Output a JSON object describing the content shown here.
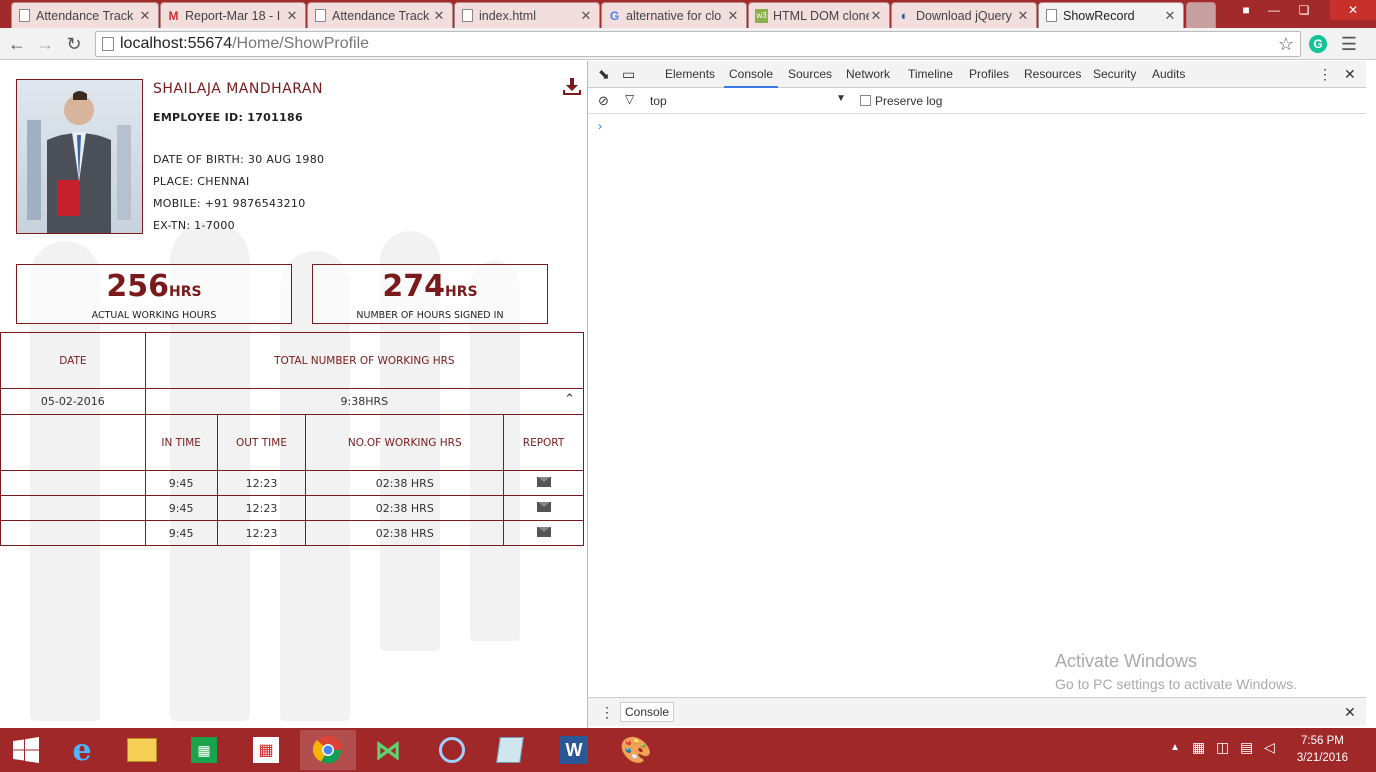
{
  "browser": {
    "tabs": [
      {
        "title": "Attendance Track",
        "icon": "document-icon"
      },
      {
        "title": "Report-Mar 18 - I",
        "icon": "gmail-icon"
      },
      {
        "title": "Attendance Track",
        "icon": "document-icon"
      },
      {
        "title": "index.html",
        "icon": "document-icon"
      },
      {
        "title": "alternative for clo",
        "icon": "google-icon"
      },
      {
        "title": "HTML DOM clone",
        "icon": "w3schools-icon"
      },
      {
        "title": "Download jQuery",
        "icon": "jquery-icon"
      },
      {
        "title": "ShowRecord",
        "icon": "document-icon"
      }
    ],
    "url_host": "localhost:55674",
    "url_path": "/Home/ShowProfile"
  },
  "profile": {
    "name": "SHAILAJA MANDHARAN",
    "employee_id": "EMPLOYEE ID: 1701186",
    "dob": "DATE OF BIRTH: 30 AUG 1980",
    "place": "PLACE: CHENNAI",
    "mobile": "MOBILE: +91 9876543210",
    "ext": "EX-TN: 1-7000"
  },
  "stats": {
    "actual": {
      "value": "256",
      "unit": "HRS",
      "label": "ACTUAL WORKING HOURS"
    },
    "signed": {
      "value": "274",
      "unit": "HRS",
      "label": "NUMBER OF HOURS SIGNED IN"
    }
  },
  "table": {
    "col_date": "DATE",
    "col_total": "TOTAL NUMBER OF WORKING HRS",
    "date": "05-02-2016",
    "total": "9:38HRS",
    "sub_headers": {
      "in": "IN TIME",
      "out": "OUT TIME",
      "working": "NO.OF WORKING HRS",
      "report": "REPORT"
    },
    "rows": [
      {
        "in": "9:45",
        "out": "12:23",
        "hrs": "02:38 HRS"
      },
      {
        "in": "9:45",
        "out": "12:23",
        "hrs": "02:38 HRS"
      },
      {
        "in": "9:45",
        "out": "12:23",
        "hrs": "02:38 HRS"
      }
    ]
  },
  "devtools": {
    "tabs": [
      "Elements",
      "Console",
      "Sources",
      "Network",
      "Timeline",
      "Profiles",
      "Resources",
      "Security",
      "Audits"
    ],
    "context": "top",
    "preserve_log": "Preserve log",
    "drawer_tab": "Console"
  },
  "watermark": {
    "line1": "Activate Windows",
    "line2": "Go to PC settings to activate Windows."
  },
  "clock": {
    "time": "7:56 PM",
    "date": "3/21/2016"
  },
  "colors": {
    "accent": "#7a1a1a",
    "taskbar": "#a12828",
    "devtools_active": "#3b78e7"
  }
}
